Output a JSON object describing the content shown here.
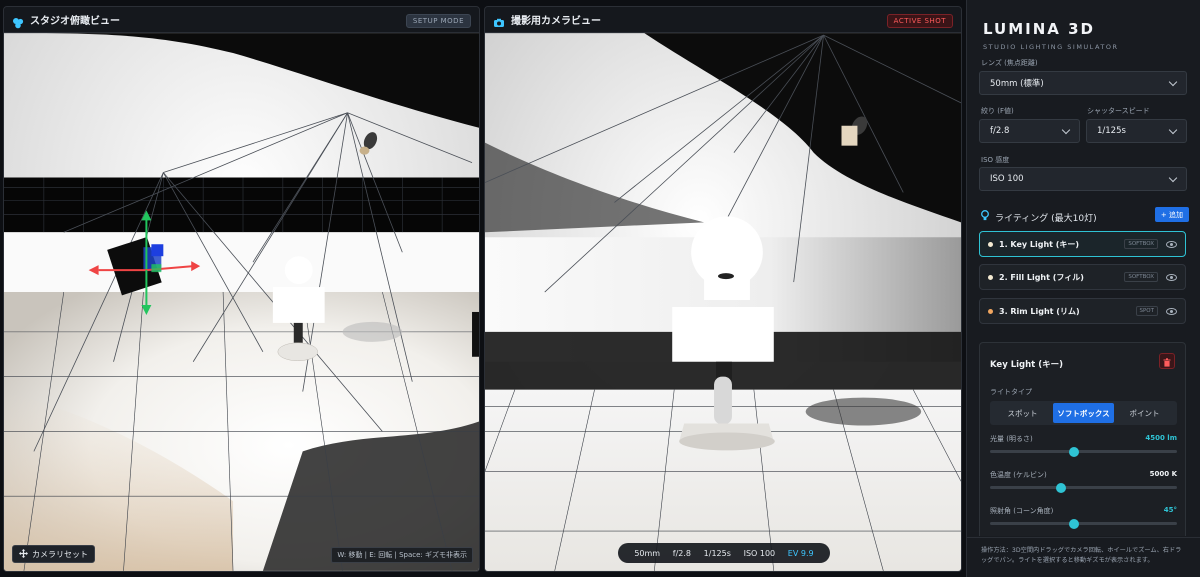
{
  "left_view": {
    "title": "スタジオ俯瞰ビュー",
    "badge": "SETUP MODE",
    "reset_label": "カメラリセット",
    "hint": "W: 移動 | E: 回転 | Space: ギズモ非表示"
  },
  "right_view": {
    "title": "撮影用カメラビュー",
    "badge": "ACTIVE SHOT",
    "stats": {
      "focal": "50mm",
      "aperture": "f/2.8",
      "shutter": "1/125s",
      "iso": "ISO 100",
      "ev": "EV 9.9"
    }
  },
  "brand": {
    "title": "LUMINA 3D",
    "subtitle": "STUDIO LIGHTING SIMULATOR"
  },
  "camera": {
    "lens_label": "レンズ (焦点距離)",
    "lens_value": "50mm (標準)",
    "aperture_label": "絞り (F値)",
    "aperture_value": "f/2.8",
    "shutter_label": "シャッタースピード",
    "shutter_value": "1/125s",
    "iso_label": "ISO 感度",
    "iso_value": "ISO 100"
  },
  "lighting": {
    "title": "ライティング (最大10灯)",
    "add_label": "+ 追加",
    "items": [
      {
        "name": "1. Key Light (キー)",
        "type": "SOFTBOX",
        "dot": "#f4ead2"
      },
      {
        "name": "2. Fill Light (フィル)",
        "type": "SOFTBOX",
        "dot": "#f4ead2"
      },
      {
        "name": "3. Rim Light (リム)",
        "type": "SPOT",
        "dot": "#f0a660"
      }
    ]
  },
  "detail": {
    "title": "Key Light (キー)",
    "type_label": "ライトタイプ",
    "types": [
      "スポット",
      "ソフトボックス",
      "ポイント"
    ],
    "intensity_label": "光量 (明るさ)",
    "intensity_value": "4500 lm",
    "intensity_level": 0.45,
    "temp_label": "色温度 (ケルビン)",
    "temp_value": "5000 K",
    "temp_level": 0.38,
    "angle_label": "照射角 (コーン角度)",
    "angle_value": "45°",
    "angle_level": 0.45
  },
  "help_text": "操作方法：3D空間内ドラッグでカメラ回転、ホイールでズーム、右ドラッグでパン。ライトを選択すると移動ギズモが表示されます。",
  "colors": {
    "accent": "#1f6fe5",
    "cyan": "#2fc3d4",
    "ev": "#3ec6ff",
    "danger": "#ff5c5c"
  }
}
